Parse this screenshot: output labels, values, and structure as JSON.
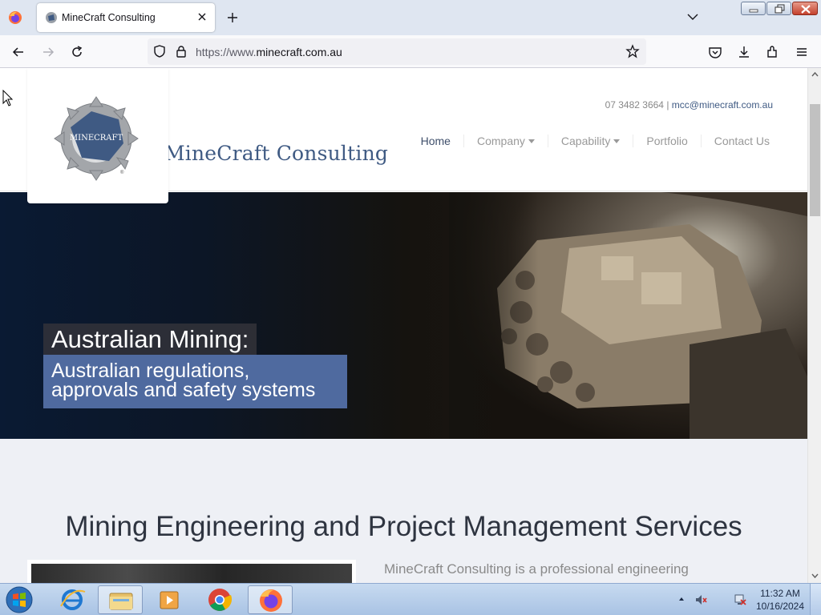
{
  "browser": {
    "tab": {
      "title": "MineCraft Consulting",
      "favicon": "minecraft-logo-favicon"
    },
    "url": {
      "prefix": "https://www.",
      "domain": "minecraft.com.au"
    },
    "icons": [
      "firefox-icon",
      "close-icon",
      "plus-icon",
      "chevron-down-icon",
      "back-icon",
      "forward-icon",
      "reload-icon",
      "shield-icon",
      "lock-icon",
      "star-icon",
      "pocket-icon",
      "download-icon",
      "extensions-icon",
      "menu-icon"
    ]
  },
  "site": {
    "logo_text": "MINECRAFT",
    "brand_name": "MineCraft Consulting",
    "contact": {
      "phone": "07 3482 3664",
      "separator": " | ",
      "email": "mcc@minecraft.com.au"
    },
    "nav": [
      {
        "label": "Home",
        "dropdown": false
      },
      {
        "label": "Company",
        "dropdown": true
      },
      {
        "label": "Capability",
        "dropdown": true
      },
      {
        "label": "Portfolio",
        "dropdown": false
      },
      {
        "label": "Contact Us",
        "dropdown": false
      }
    ],
    "hero": {
      "title": "Australian Mining:",
      "subtitle_line1": "Australian regulations,",
      "subtitle_line2": "approvals and safety systems"
    },
    "section": {
      "title": "Mining Engineering and Project Management Services",
      "intro": "MineCraft Consulting is a professional engineering"
    }
  },
  "taskbar": {
    "apps": [
      "windows-start-icon",
      "internet-explorer-icon",
      "file-explorer-icon",
      "media-player-icon",
      "chrome-icon",
      "firefox-icon"
    ],
    "clock": {
      "time": "11:32 AM",
      "date": "10/16/2024"
    }
  },
  "colors": {
    "brand": "#3f5a83",
    "hero_sub_bg": "#4f6a9f",
    "page_section_bg": "#eef0f5"
  }
}
